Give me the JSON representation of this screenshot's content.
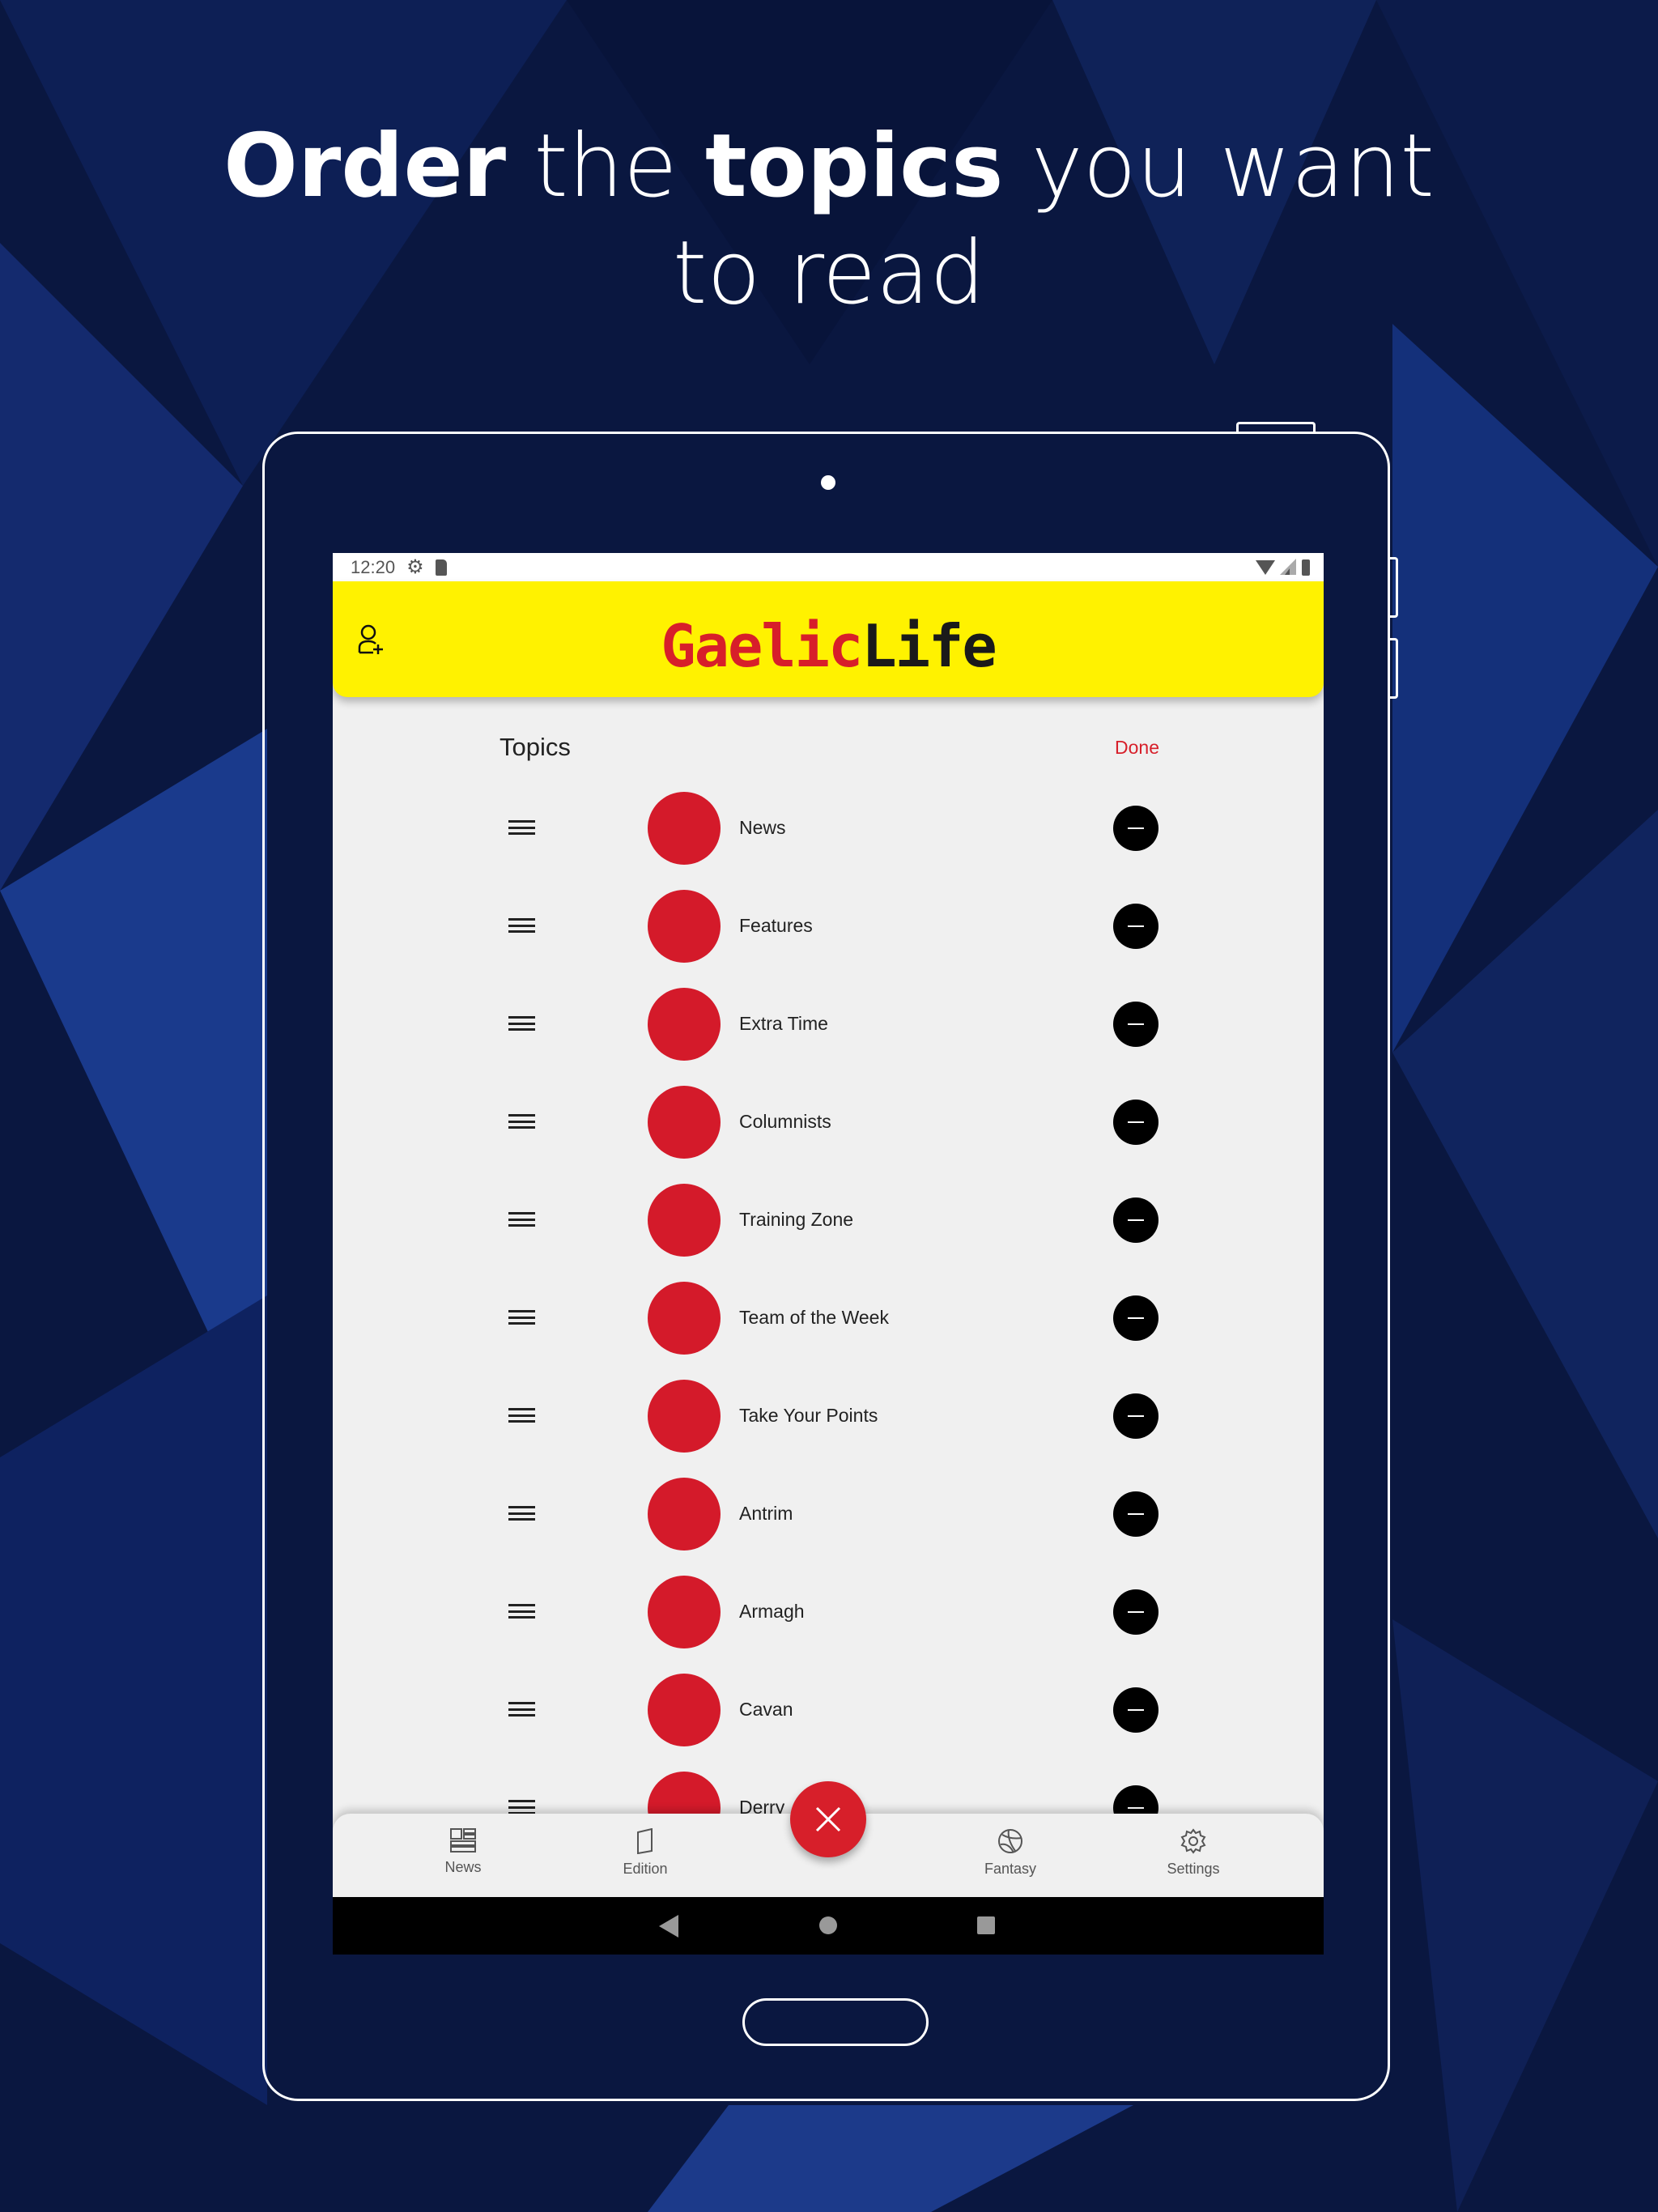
{
  "headline": {
    "w1": "Order",
    "w2": " the ",
    "w3": "topics",
    "w4": " you want to read"
  },
  "status": {
    "time": "12:20"
  },
  "app": {
    "logo_red": "Gaelic",
    "logo_black": "Life"
  },
  "topics": {
    "title": "Topics",
    "done_label": "Done",
    "items": [
      "News",
      "Features",
      "Extra Time",
      "Columnists",
      "Training Zone",
      "Team of the Week",
      "Take Your Points",
      "Antrim",
      "Armagh",
      "Cavan",
      "Derry"
    ]
  },
  "bottom_nav": {
    "items": [
      "News",
      "Edition",
      "Fantasy",
      "Settings"
    ]
  },
  "colors": {
    "accent": "#d71f2a",
    "header": "#fff200",
    "background": "#0b1a45"
  }
}
